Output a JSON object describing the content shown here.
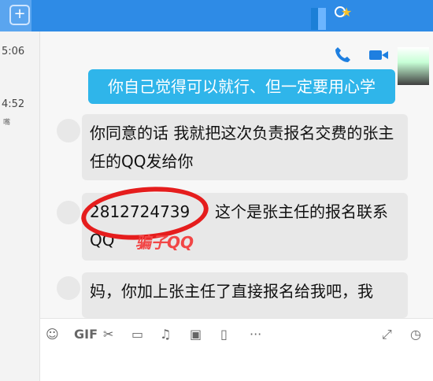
{
  "left_panel": {
    "plus_label": "+",
    "times": [
      "5:06",
      "4:52"
    ],
    "snippet": "嘴"
  },
  "chat": {
    "outgoing": "你自己觉得可以就行、但一定要用心学",
    "incoming": [
      "你同意的话 我就把这次负责报名交费的张主任的QQ发给你",
      "2812724739   这个是张主任的报名联系QQ",
      "妈，你加上张主任了直接报名给我吧，我"
    ],
    "qq_number": "2812724739",
    "scam_label": "骗子QQ"
  },
  "toolbar": {
    "emoji_icon": "emoji-icon",
    "gif_label": "GIF",
    "scissors_icon": "scissors-icon",
    "folder_icon": "folder-icon",
    "music_icon": "music-icon",
    "image_icon": "image-icon",
    "phone_icon": "phone-icon",
    "more_label": "···",
    "expand_icon": "expand-icon",
    "clock_icon": "clock-icon"
  },
  "colors": {
    "topbar": "#2e8be6",
    "bubble": "#2fb5ea",
    "scam_circle": "#e51d1d"
  }
}
